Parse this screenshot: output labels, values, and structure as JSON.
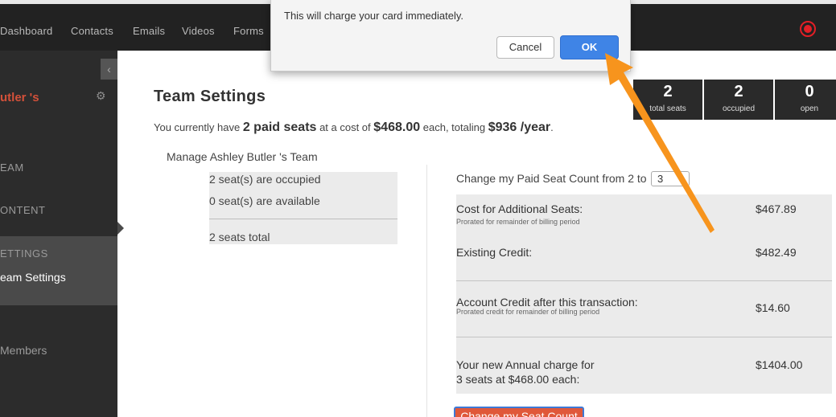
{
  "nav": {
    "items": [
      "Dashboard",
      "Contacts",
      "Emails",
      "Videos",
      "Forms"
    ],
    "record_icon": "record-icon",
    "accent_color": "#e21f26"
  },
  "sidebar": {
    "team_name": "utler 's",
    "collapse_icon": "chevron-left-icon",
    "settings_icon": "gear-icon",
    "team_label": "EAM",
    "content_label": "ONTENT",
    "settings_label": "ETTINGS",
    "team_settings_item": "eam Settings",
    "members_item": "Members"
  },
  "main": {
    "title": "Team Settings",
    "summary": {
      "prefix": "You currently have",
      "seats": "2 paid seats",
      "cost_prefix": "at a cost of",
      "cost": "$468.00",
      "each_totaling": "each, totaling",
      "total": "$936 /year",
      "suffix": "."
    },
    "stats": [
      {
        "value": "2",
        "label": "total seats"
      },
      {
        "value": "2",
        "label": "occupied"
      },
      {
        "value": "0",
        "label": "open"
      }
    ],
    "manage_title": "Manage Ashley Butler 's Team",
    "occupancy": {
      "occupied": "2 seat(s) are occupied",
      "available": "0 seat(s) are available",
      "total": "2 seats total"
    },
    "change_label": "Change my Paid Seat Count from 2 to",
    "seat_select_value": "3",
    "cost_table": {
      "additional_label": "Cost for Additional Seats:",
      "additional_sub": "Prorated for remainder of billing period",
      "additional_value": "$467.89",
      "credit_label": "Existing Credit:",
      "credit_value": "$482.49",
      "after_label": "Account Credit after this transaction:",
      "after_sub": "Prorated credit for remainder of billing period",
      "after_value": "$14.60",
      "annual_label_1": "Your new Annual charge for",
      "annual_label_2": "3 seats at $468.00 each:",
      "annual_value": "$1404.00"
    },
    "change_button": "Change my Seat Count",
    "button_color": "#e0583a"
  },
  "dialog": {
    "message": "This will charge your card immediately.",
    "cancel_label": "Cancel",
    "ok_label": "OK",
    "ok_color": "#3f84e6"
  },
  "annotation": {
    "arrow_color": "#f7941d"
  }
}
